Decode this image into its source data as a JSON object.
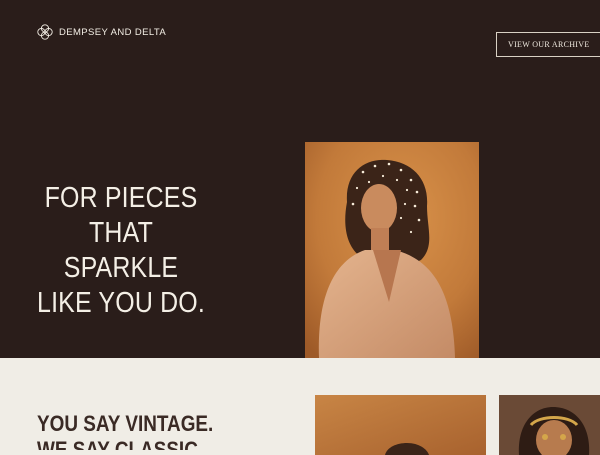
{
  "brand": {
    "name": "DEMPSEY AND DELTA",
    "icon": "knot-logo-icon"
  },
  "header": {
    "archive_button_label": "VIEW OUR ARCHIVE"
  },
  "hero": {
    "headline_lines": [
      "FOR PIECES",
      "THAT SPARKLE",
      "LIKE YOU DO."
    ],
    "photo": "portrait-woman-sparkle-headscarf"
  },
  "section2": {
    "headline_lines": [
      "YOU SAY VINTAGE.",
      "WE SAY CLASSIC."
    ],
    "photos": [
      "portrait-amber-light",
      "portrait-gold-headpiece"
    ]
  },
  "colors": {
    "dark_bg": "#2a1d1a",
    "light_bg": "#f0ede6",
    "accent_amber": "#c27a3a",
    "text_light": "#f4efe6",
    "text_dark": "#3a2a25"
  }
}
